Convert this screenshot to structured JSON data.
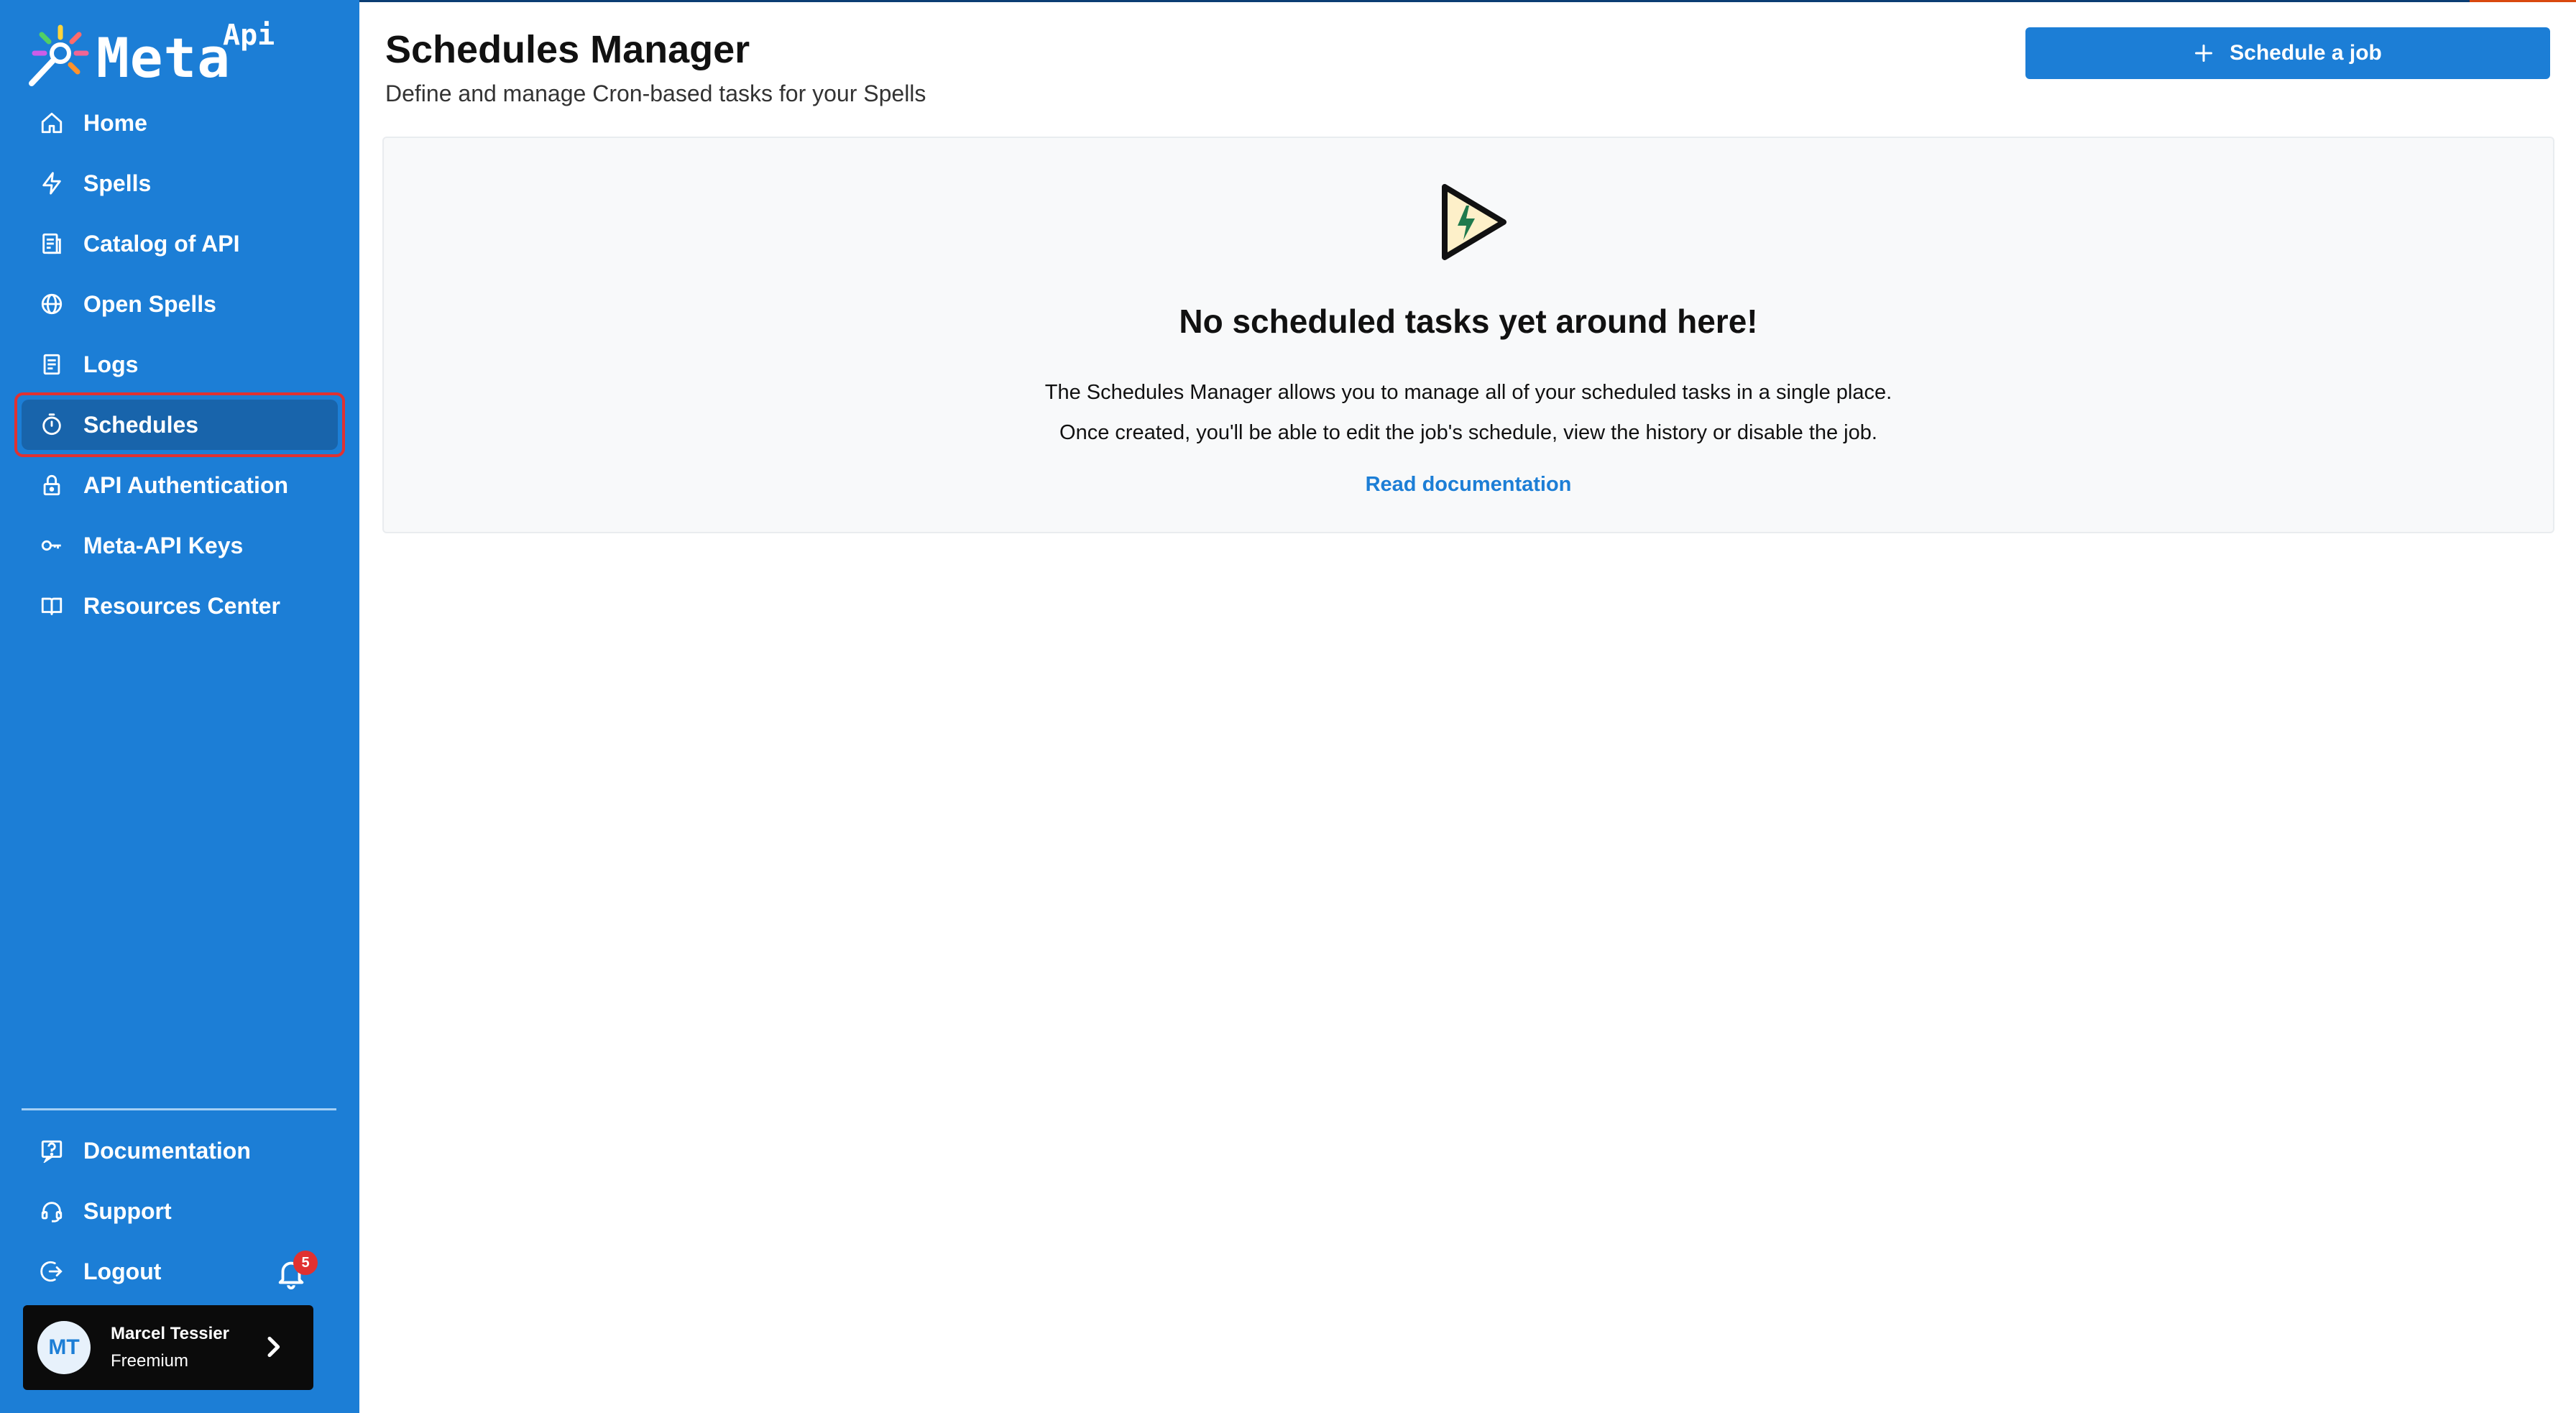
{
  "brand": {
    "name": "Meta",
    "superscript": "Api"
  },
  "sidebar": {
    "items": [
      {
        "label": "Home",
        "icon": "home-icon"
      },
      {
        "label": "Spells",
        "icon": "bolt-icon"
      },
      {
        "label": "Catalog of API",
        "icon": "catalog-icon"
      },
      {
        "label": "Open Spells",
        "icon": "globe-icon"
      },
      {
        "label": "Logs",
        "icon": "logs-icon"
      },
      {
        "label": "Schedules",
        "icon": "stopwatch-icon",
        "active": true
      },
      {
        "label": "API Authentication",
        "icon": "lock-icon"
      },
      {
        "label": "Meta-API Keys",
        "icon": "key-icon"
      },
      {
        "label": "Resources Center",
        "icon": "book-icon"
      }
    ],
    "bottom_items": [
      {
        "label": "Documentation",
        "icon": "help-icon"
      },
      {
        "label": "Support",
        "icon": "headset-icon"
      },
      {
        "label": "Logout",
        "icon": "logout-icon"
      }
    ],
    "notifications": {
      "count": "5"
    },
    "user": {
      "initials": "MT",
      "name": "Marcel Tessier",
      "plan": "Freemium"
    }
  },
  "header": {
    "title": "Schedules Manager",
    "subtitle": "Define and manage Cron-based tasks for your Spells",
    "action_label": "Schedule a job",
    "action_icon": "plus-icon"
  },
  "empty_state": {
    "title": "No scheduled tasks yet around here!",
    "line1": "The Schedules Manager allows you to manage all of your scheduled tasks in a single place.",
    "line2": "Once created, you'll be able to edit the job's schedule, view the history or disable the job.",
    "link": "Read documentation"
  },
  "colors": {
    "primary": "#1c7ed6",
    "active": "#1864ab",
    "highlight": "#e03131",
    "card": "#f8f9fa"
  }
}
